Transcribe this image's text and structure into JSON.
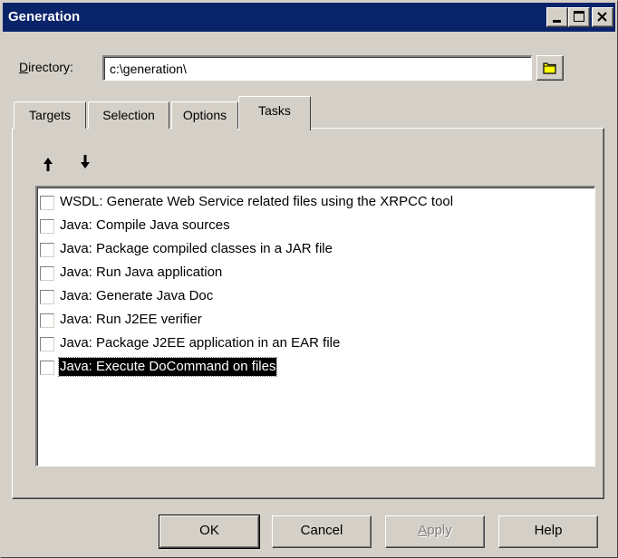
{
  "window": {
    "title": "Generation",
    "controls": [
      "minimize-icon",
      "maximize-icon",
      "close-icon"
    ]
  },
  "directory": {
    "label_prefix": "D",
    "label_rest": "irectory:",
    "value": "c:\\generation\\"
  },
  "tabs": [
    {
      "label": "Targets",
      "active": false
    },
    {
      "label": "Selection",
      "active": false
    },
    {
      "label": "Options",
      "active": false
    },
    {
      "label": "Tasks",
      "active": true
    }
  ],
  "tasks": {
    "move_up_icon": "arrow-up-icon",
    "move_down_icon": "arrow-down-icon",
    "items": [
      {
        "label": "WSDL: Generate Web Service related files using the XRPCC tool",
        "checked": false
      },
      {
        "label": "Java: Compile Java sources",
        "checked": false
      },
      {
        "label": "Java: Package compiled classes in a JAR file",
        "checked": false
      },
      {
        "label": "Java: Run Java application",
        "checked": false
      },
      {
        "label": "Java: Generate Java Doc",
        "checked": false
      },
      {
        "label": "Java: Run J2EE verifier",
        "checked": false
      },
      {
        "label": "Java: Package J2EE application in an EAR file",
        "checked": false
      },
      {
        "label": "Java: Execute DoCommand on files",
        "checked": false,
        "selected": true
      }
    ]
  },
  "buttons": {
    "ok": "OK",
    "cancel": "Cancel",
    "apply_prefix": "A",
    "apply_rest": "pply",
    "help": "Help"
  },
  "colors": {
    "titlebar": "#0a246a",
    "face": "#d4d0c8",
    "selection": "#000000",
    "folder_icon": "#ffff00"
  }
}
